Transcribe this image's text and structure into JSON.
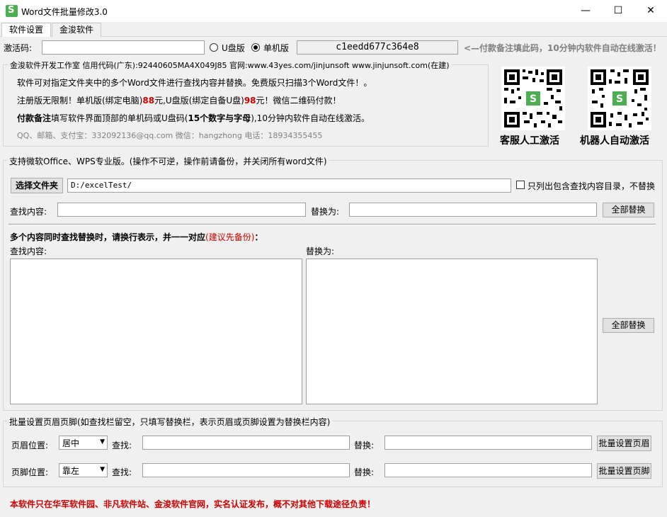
{
  "window": {
    "title": "Word文件批量修改3.0",
    "minimize": "—",
    "maximize": "☐",
    "close": "✕"
  },
  "tabs": [
    {
      "label": "软件设置"
    },
    {
      "label": "金浚软件"
    }
  ],
  "activation": {
    "label": "激活码:",
    "code_value": "",
    "option_usb": "U盘版",
    "option_pc": "单机版",
    "machine_code": "c1eedd677c364e8",
    "notice": "<—付款备注填此码，10分钟内软件自动在线激活！"
  },
  "info": {
    "company": "金浚软件开发工作室 信用代码(广东):92440605MA4X049J85 官网:www.43yes.com/jinjunsoft  www.jinjunsoft.com(在建)",
    "line1": "软件可对指定文件夹中的多个Word文件进行查找内容并替换。免费版只扫描3个Word文件！。",
    "line2_a": "注册版无限制！单机版(绑定电脑)",
    "line2_price1": "88",
    "line2_b": "元,U盘版(绑定自备U盘)",
    "line2_price2": "98",
    "line2_c": "元！微信二维码付款！",
    "line3_a": "付款备注",
    "line3_b": "填写软件界面顶部的单机码或U盘码(",
    "line3_c": "15个数字与字母",
    "line3_d": "),10分钟内软件自动在线激活。",
    "contact": "QQ、邮箱、支付宝：332092136@qq.com   微信：hangzhong   电话：18934355455",
    "qr1_label": "客服人工激活",
    "qr2_label": "机器人自动激活"
  },
  "main": {
    "group_title": "支持微软Office、WPS专业版。(操作不可逆，操作前请备份，并关闭所有word文件)",
    "choose_folder": "选择文件夹",
    "folder_path": "D:/excelTest/",
    "only_list": "只列出包含查找内容目录，不替换",
    "find_label": "查找内容:",
    "find_value": "",
    "replace_label": "替换为:",
    "replace_value": "",
    "replace_all": "全部替换",
    "multi_title_a": "多个内容同时查找替换时，请换行表示，并一一对应",
    "multi_title_b": "(建议先备份)",
    "multi_title_c": "：",
    "multi_find_label": "查找内容:",
    "multi_replace_label": "替换为:",
    "multi_replace_all": "全部替换"
  },
  "headerfooter": {
    "group_title": "批量设置页眉页脚(如查找栏留空，只填写替换栏，表示页眉或页脚设置为替换栏内容)",
    "header_pos_label": "页眉位置:",
    "header_pos_value": "居中",
    "header_find_label": "查找:",
    "header_replace_label": "替换:",
    "header_button": "批量设置页眉",
    "footer_pos_label": "页脚位置:",
    "footer_pos_value": "靠左",
    "footer_find_label": "查找:",
    "footer_replace_label": "替换:",
    "footer_button": "批量设置页脚"
  },
  "footer_notice": "本软件只在华军软件园、非凡软件站、金浚软件官网，实名认证发布，概不对其他下载途径负责！",
  "colors": {
    "red": "#d00000",
    "notice_gray": "#808080"
  }
}
